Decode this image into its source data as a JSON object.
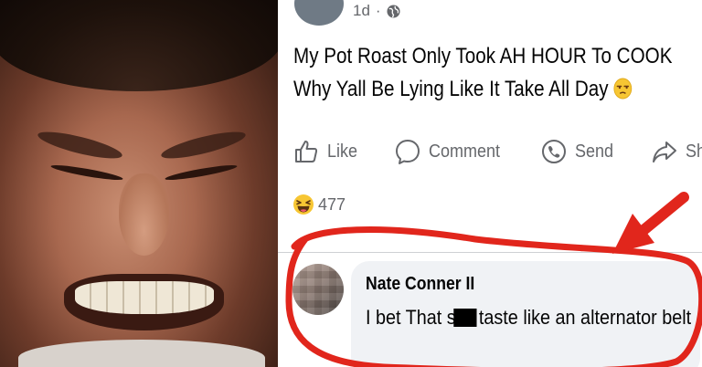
{
  "post": {
    "timestamp": "1d",
    "privacy_icon": "globe-icon",
    "text_line1": "My Pot Roast Only Took AH HOUR To COOK",
    "text_line2": "Why Yall Be Lying Like It Take All Day",
    "text_emoji": "unamused-face-emoji"
  },
  "actions": {
    "like_label": "Like",
    "comment_label": "Comment",
    "send_label": "Send",
    "share_label": "Share"
  },
  "reactions": {
    "icon": "laughing-emoji-icon",
    "count": "477"
  },
  "comment": {
    "author": "Nate Conner II",
    "text_before_censor": "I bet That s",
    "text_after_censor": "taste like an alternator belt"
  },
  "colors": {
    "annotation_red": "#e1261c",
    "text_primary": "#050505",
    "text_secondary": "#65676b",
    "comment_bubble": "#f0f2f5"
  }
}
